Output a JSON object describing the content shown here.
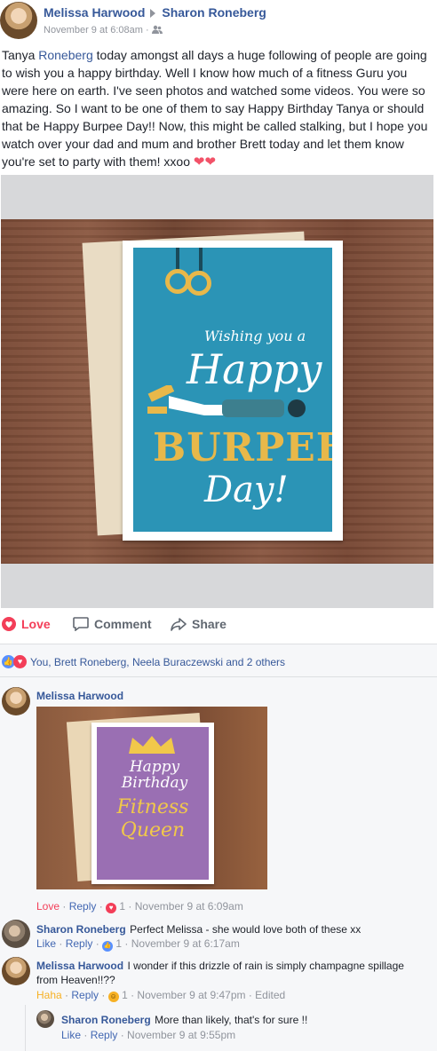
{
  "post": {
    "author": "Melissa Harwood",
    "recipient": "Sharon Roneberg",
    "timestamp": "November 9 at 6:08am",
    "audience_separator": "·",
    "text_before": "Tanya ",
    "text_tag": "Roneberg",
    "text_after": " today amongst all days a huge following of people are going to wish you a happy birthday. Well I know how much of a fitness Guru you were here on earth. I've seen photos and watched some videos. You were so amazing. So I want to be one of them to say Happy Birthday Tanya or should that be Happy Burpee Day!! Now, this might be called stalking, but I hope you watch over your dad and mum and brother Brett today and let them know you're set to party with them! xxoo ",
    "hearts": "❤❤",
    "image": {
      "wish_text": "Wishing you a",
      "happy_text": "Happy",
      "burpee_text": "BURPEE",
      "day_text": "Day!"
    }
  },
  "actions": {
    "love": "Love",
    "comment": "Comment",
    "share": "Share"
  },
  "reactions": {
    "summary": "You, Brett Roneberg, Neela Buraczewski and 2 others"
  },
  "comments": [
    {
      "author": "Melissa Harwood",
      "text": "",
      "has_photo": true,
      "photo": {
        "line1": "Happy",
        "line2": "Birthday",
        "line3": "Fitness",
        "line4": "Queen"
      },
      "reaction_label": "Love",
      "reply": "Reply",
      "reaction_count": "1",
      "time": "November 9 at 6:09am"
    },
    {
      "author": "Sharon Roneberg",
      "text": "Perfect Melissa - she would love both of these xx",
      "reaction_label": "Like",
      "reply": "Reply",
      "reaction_count": "1",
      "time": "November 9 at 6:17am"
    },
    {
      "author": "Melissa Harwood",
      "text": "I wonder if this drizzle of rain is simply champagne spillage from Heaven!!??",
      "reaction_label": "Haha",
      "reply": "Reply",
      "reaction_count": "1",
      "time": "November 9 at 9:47pm",
      "edited": "Edited"
    },
    {
      "author": "Sharon Roneberg",
      "text": "More than likely, that's for sure !!",
      "reaction_label": "Like",
      "reply": "Reply",
      "time": "November 9 at 9:55pm"
    }
  ],
  "colors": {
    "link": "#365899",
    "love": "#f33e58",
    "haha": "#f7b125",
    "meta": "#90949c"
  }
}
